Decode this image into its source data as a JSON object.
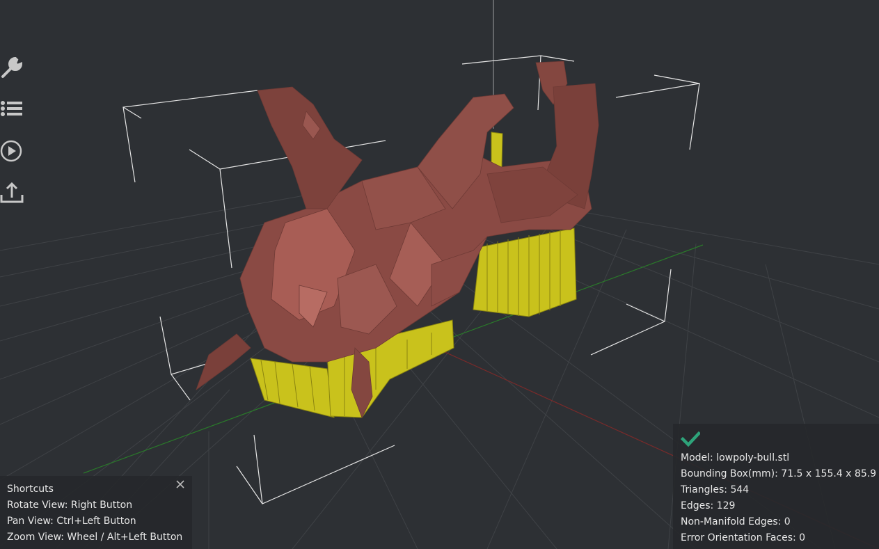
{
  "colors": {
    "background": "#2d3034",
    "grid": "#3d4044",
    "model": "#8a4a44",
    "support": "#c9c21c",
    "bbox": "#e6e6e6",
    "axis_x": "#7a2a2a",
    "axis_y": "#2a7a2a",
    "check": "#2ea37a"
  },
  "toolbar": [
    {
      "icon": "wrench-icon"
    },
    {
      "icon": "list-icon"
    },
    {
      "icon": "play-icon"
    },
    {
      "icon": "upload-icon"
    }
  ],
  "shortcuts": {
    "title": "Shortcuts",
    "items": [
      "Rotate View: Right Button",
      "Pan View: Ctrl+Left Button",
      "Zoom View: Wheel / Alt+Left Button"
    ]
  },
  "model_info": {
    "status_icon": "checkmark-icon",
    "model": "Model: lowpoly-bull.stl",
    "bounding_box": "Bounding Box(mm): 71.5 x 155.4 x 85.9",
    "triangles": "Triangles: 544",
    "edges": "Edges: 129",
    "non_manifold": "Non-Manifold Edges: 0",
    "error_orientation": "Error Orientation Faces: 0"
  }
}
